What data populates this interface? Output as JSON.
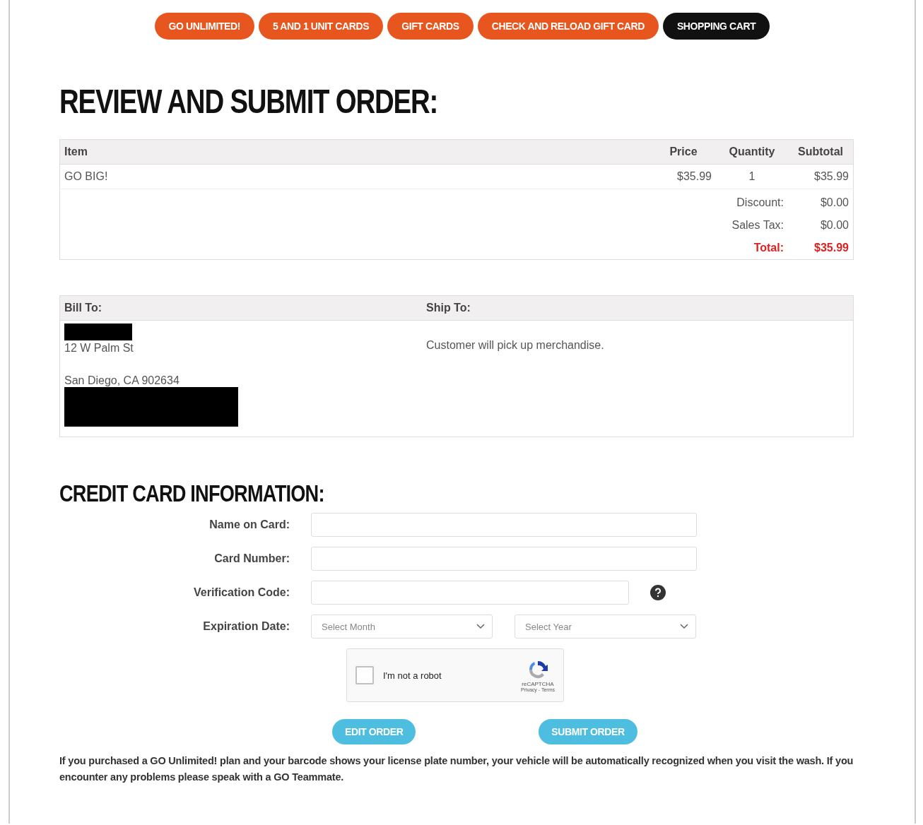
{
  "nav": [
    {
      "label": "GO UNLIMITED!",
      "selected": false
    },
    {
      "label": "5 AND 1 UNIT CARDS",
      "selected": false
    },
    {
      "label": "GIFT CARDS",
      "selected": false
    },
    {
      "label": "CHECK AND RELOAD GIFT CARD",
      "selected": false
    },
    {
      "label": "SHOPPING CART",
      "selected": true
    }
  ],
  "title": "REVIEW AND SUBMIT ORDER:",
  "order_table": {
    "columns": [
      "Item",
      "Price",
      "Quantity",
      "Subtotal"
    ],
    "rows": [
      {
        "item": "GO BIG!",
        "price": "$35.99",
        "quantity": "1",
        "subtotal": "$35.99"
      }
    ],
    "summary": [
      {
        "label": "Discount:",
        "value": "$0.00",
        "kind": "plain"
      },
      {
        "label": "Sales Tax:",
        "value": "$0.00",
        "kind": "plain"
      },
      {
        "label": "Total:",
        "value": "$35.99",
        "kind": "total"
      }
    ]
  },
  "address_table": {
    "bill_to_heading": "Bill To:",
    "ship_to_heading": "Ship To:",
    "bill_to_lines": [
      "12 W Palm St",
      "San Diego, CA 902634"
    ],
    "ship_to_text": "Customer will pick up merchandise."
  },
  "credit_card": {
    "heading": "CREDIT CARD INFORMATION:",
    "fields": [
      {
        "label": "Name on Card:",
        "kind": "text"
      },
      {
        "label": "Card Number:",
        "kind": "text"
      },
      {
        "label": "Verification Code:",
        "kind": "code"
      },
      {
        "label": "Expiration Date:",
        "kind": "selects",
        "month_placeholder": "Select Month",
        "year_placeholder": "Select Year"
      }
    ],
    "captcha": {
      "label": "I'm not a robot",
      "checked": false,
      "brand": "reCAPTCHA",
      "links": "Privacy - Terms"
    }
  },
  "buttons": [
    "EDIT ORDER",
    "SUBMIT ORDER"
  ],
  "footnote": "If you purchased a GO Unlimited! plan and your barcode shows your license plate number, your vehicle will be automatically recognized when you visit the wash. If you encounter any problems please speak with a GO Teammate."
}
